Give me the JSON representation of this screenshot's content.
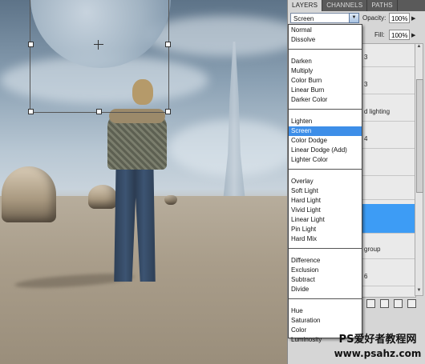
{
  "panel": {
    "tabs": [
      "LAYERS",
      "CHANNELS",
      "PATHS"
    ],
    "blend_mode": "Screen",
    "opacity_label": "Opacity:",
    "opacity_value": "100%",
    "fill_label": "Fill:",
    "fill_value": "100%",
    "layer_fragments": [
      "3",
      "3",
      "d lighting",
      "4",
      "group",
      "6"
    ]
  },
  "blend_menu": {
    "groups": [
      [
        "Normal",
        "Dissolve"
      ],
      [
        "Darken",
        "Multiply",
        "Color Burn",
        "Linear Burn",
        "Darker Color"
      ],
      [
        "Lighten",
        "Screen",
        "Color Dodge",
        "Linear Dodge (Add)",
        "Lighter Color"
      ],
      [
        "Overlay",
        "Soft Light",
        "Hard Light",
        "Vivid Light",
        "Linear Light",
        "Pin Light",
        "Hard Mix"
      ],
      [
        "Difference",
        "Exclusion",
        "Subtract",
        "Divide"
      ],
      [
        "Hue",
        "Saturation",
        "Color",
        "Luminosity"
      ]
    ],
    "highlighted": "Screen"
  },
  "watermark": {
    "line1": "PS爱好者教程网",
    "line2": "www.psahz.com"
  },
  "colors": {
    "highlight": "#3d8ee8",
    "selected_layer": "#3d9cf5"
  }
}
